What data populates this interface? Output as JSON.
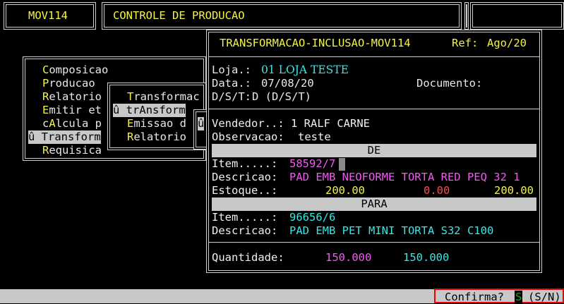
{
  "header": {
    "program_code": "MOV114",
    "module_title": "CONTROLE DE PRODUCAO"
  },
  "main_menu": {
    "items": [
      {
        "hot": "C",
        "rest": "omposicao"
      },
      {
        "hot": "P",
        "rest": "roducao"
      },
      {
        "hot": "R",
        "rest": "elatorio"
      },
      {
        "hot": "E",
        "rest": "mitir et"
      },
      {
        "hot": "c",
        "rest": "A",
        "rest2": "lcula p"
      },
      {
        "prefix": "û ",
        "hot": "T",
        "rest": "ransform"
      },
      {
        "hot": "R",
        "rest": "equisica"
      }
    ]
  },
  "sub_menu": {
    "items": [
      {
        "hot": "T",
        "rest": "ransformac"
      },
      {
        "prefix": "û ",
        "pre": "tr",
        "hot": "A",
        "rest": "nsform"
      },
      {
        "hot": "E",
        "rest": "missao d"
      },
      {
        "hot": "R",
        "rest": "elatorio"
      }
    ]
  },
  "sub_sub_menu": {
    "glyph": "û"
  },
  "dialog": {
    "title": "TRANSFORMACAO-INCLUSAO-MOV114",
    "ref_label": "Ref:",
    "ref_value": "Ago/20",
    "loja_label": "Loja.:",
    "loja_value": "01 LOJA TESTE",
    "data_label": "Data.:",
    "data_value": "07/08/20",
    "documento_label": "Documento:",
    "dst_label": "D/S/T:",
    "dst_value": "D (D/S/T)",
    "vendedor_label": "Vendedor..:",
    "vendedor_value": "1 RALF CARNE",
    "observacao_label": "Observacao:",
    "observacao_value": "teste",
    "de_section": "DE",
    "de_item_label": "Item.....:",
    "de_item_value": "58592/7",
    "de_descricao_label": "Descricao:",
    "de_descricao_value": "PAD EMB NEOFORME TORTA RED PEQ 32 1",
    "estoque_label": "Estoque..:",
    "estoque_value_1": "200.00",
    "estoque_value_2": "0.00",
    "estoque_value_3": "200.00",
    "para_section": "PARA",
    "para_item_label": "Item.....:",
    "para_item_value": "96656/6",
    "para_descricao_label": "Descricao:",
    "para_descricao_value": "PAD EMB PET MINI TORTA S32 C100",
    "quantidade_label": "Quantidade:",
    "quantidade_value_1": "150.000",
    "quantidade_value_2": "150.000"
  },
  "status_bar": {
    "confirm_label": "Confirma?",
    "confirm_value": "S",
    "confirm_options": "(S/N)"
  },
  "colors": {
    "background": "#000000",
    "yellow": "#f2f24a",
    "cyan": "#39e6e6",
    "magenta": "#f05af0",
    "red": "#ff4a4a",
    "bar_gray": "#c8c8c8",
    "highlight_border": "#e00000"
  }
}
